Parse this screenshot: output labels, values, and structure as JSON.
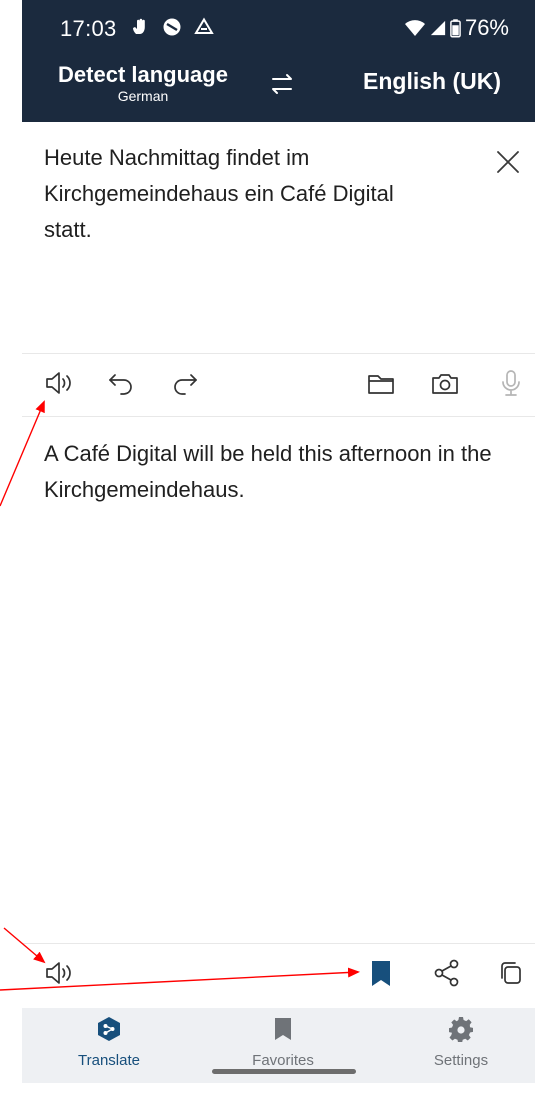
{
  "status_bar": {
    "time": "17:03",
    "battery": "76%"
  },
  "languages": {
    "source": "Detect language",
    "detected": "German",
    "target": "English (UK)"
  },
  "source": {
    "text": "Heute Nachmittag findet im Kirchgemeindehaus ein Café Digital statt."
  },
  "translation": {
    "text": "A Café Digital will be held this afternoon in the Kirchgemeindehaus."
  },
  "icons": {
    "status": [
      "hand-icon",
      "blocked-icon",
      "drive-icon",
      "wifi-icon",
      "signal-icon",
      "battery-icon"
    ],
    "source_toolbar": [
      "speaker-icon",
      "undo-icon",
      "redo-icon",
      "folder-icon",
      "camera-icon",
      "microphone-icon"
    ],
    "target_toolbar": [
      "speaker-icon",
      "bookmark-icon",
      "share-icon",
      "copy-icon"
    ]
  },
  "nav": [
    {
      "label": "Translate",
      "icon": "deepl-logo-icon",
      "active": true
    },
    {
      "label": "Favorites",
      "icon": "bookmark-icon",
      "active": false
    },
    {
      "label": "Settings",
      "icon": "gear-icon",
      "active": false
    }
  ],
  "colors": {
    "header_bg": "#1b2a3e",
    "accent": "#174f7c",
    "nav_bg": "#eef0f3",
    "annotation": "#ff0000"
  }
}
